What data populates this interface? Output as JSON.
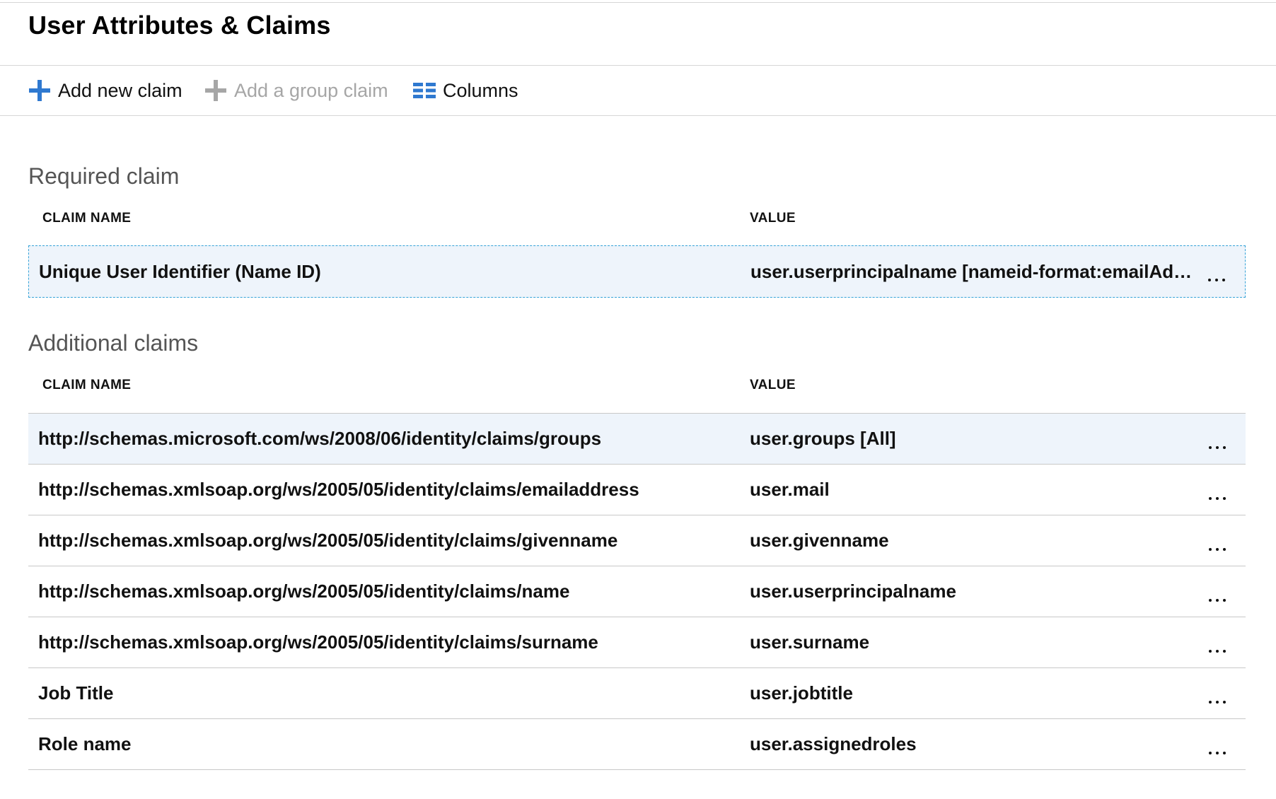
{
  "blade": {
    "title": "User Attributes & Claims"
  },
  "toolbar": {
    "add_new_claim": "Add new claim",
    "add_group_claim": "Add a group claim",
    "columns": "Columns"
  },
  "required": {
    "section_title": "Required claim",
    "col_name": "CLAIM NAME",
    "col_value": "VALUE",
    "rows": [
      {
        "name": "Unique User Identifier (Name ID)",
        "value": "user.userprincipalname [nameid-format:emailAddress]"
      }
    ]
  },
  "additional": {
    "section_title": "Additional claims",
    "col_name": "CLAIM NAME",
    "col_value": "VALUE",
    "rows": [
      {
        "name": "http://schemas.microsoft.com/ws/2008/06/identity/claims/groups",
        "value": "user.groups [All]"
      },
      {
        "name": "http://schemas.xmlsoap.org/ws/2005/05/identity/claims/emailaddress",
        "value": "user.mail"
      },
      {
        "name": "http://schemas.xmlsoap.org/ws/2005/05/identity/claims/givenname",
        "value": "user.givenname"
      },
      {
        "name": "http://schemas.xmlsoap.org/ws/2005/05/identity/claims/name",
        "value": "user.userprincipalname"
      },
      {
        "name": "http://schemas.xmlsoap.org/ws/2005/05/identity/claims/surname",
        "value": "user.surname"
      },
      {
        "name": "Job Title",
        "value": "user.jobtitle"
      },
      {
        "name": "Role name",
        "value": "user.assignedroles"
      }
    ]
  },
  "icons": {
    "add": "plus-icon",
    "group": "plus-icon",
    "columns": "columns-icon",
    "more": "more-ellipsis-icon"
  },
  "colors": {
    "accent": "#2f79d0",
    "disabled": "#a6a6a6",
    "selected_row_bg": "#eef4fb",
    "focus_border": "#35a3d8"
  }
}
